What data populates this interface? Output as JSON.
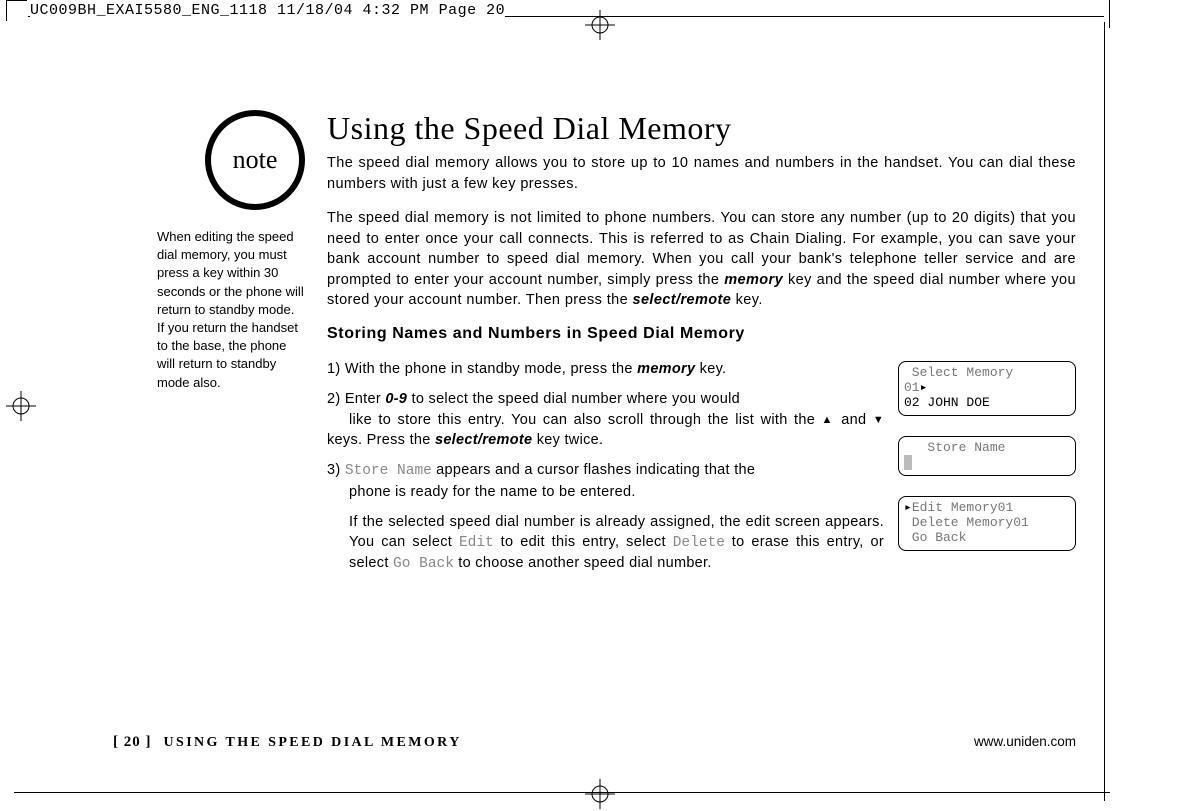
{
  "meta": {
    "slug": "UC009BH_EXAI5580_ENG_1118  11/18/04  4:32 PM  Page 20"
  },
  "sidebar": {
    "badge": "note",
    "note": "When editing the speed dial memory, you must press a key within 30 seconds or the phone will return to standby mode. If you return the handset to the base, the phone will return to standby mode also."
  },
  "main": {
    "title": "Using the Speed Dial Memory",
    "intro1": "The speed dial memory allows you to store up to 10 names and numbers in the handset. You can dial these numbers with just a few key presses.",
    "heading": "Storing Names and Numbers in Speed Dial Memory",
    "keys": {
      "memory": "memory",
      "select_remote": "select/remote",
      "range": "0-9"
    },
    "lcd": {
      "select": {
        "line1": " Select Memory",
        "line2": "01▸",
        "line3": "02 JOHN DOE"
      },
      "store": {
        "line1": "   Store Name"
      },
      "edit": {
        "line1": "▸Edit Memory01",
        "line2": " Delete Memory01",
        "line3": " Go Back"
      }
    },
    "mono_terms": {
      "store_name": "Store Name",
      "edit": "Edit",
      "delete": "Delete",
      "go_back": "Go Back"
    }
  },
  "footer": {
    "page": "[ 20 ]",
    "title": "USING THE SPEED DIAL MEMORY",
    "url": "www.uniden.com"
  }
}
